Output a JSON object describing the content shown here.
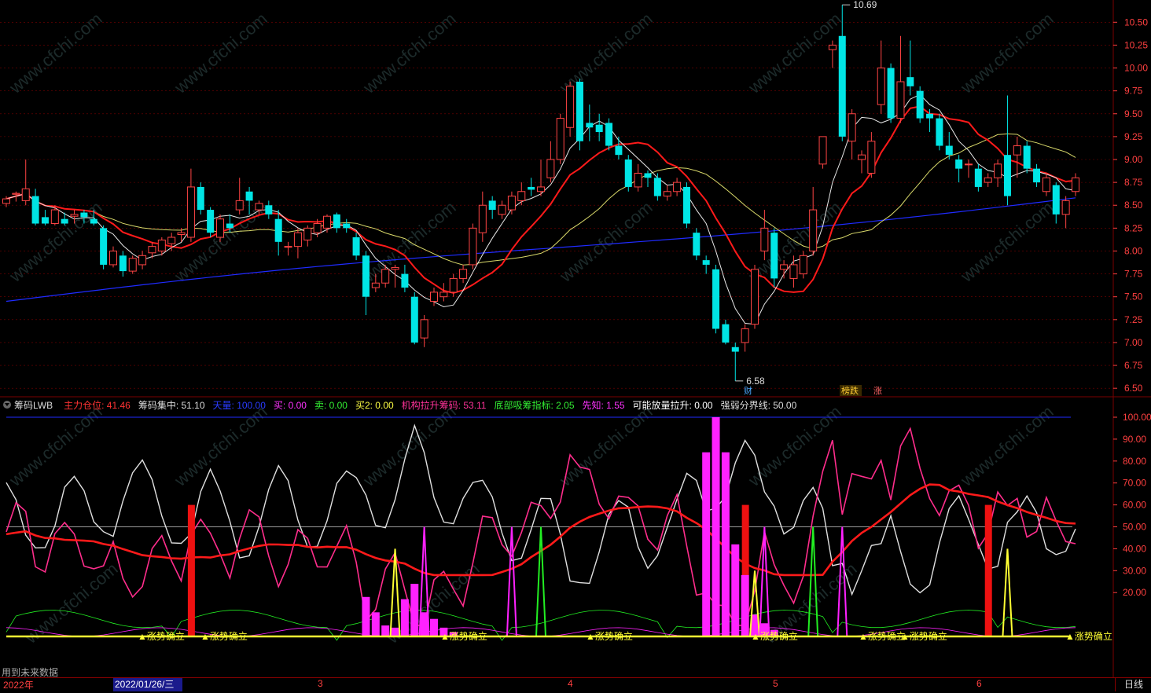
{
  "colors": {
    "up": "#ff4444",
    "down": "#00e5e5",
    "ma_red": "#ff1a1a",
    "ma_white": "#e8e8e8",
    "ma_yellow": "#d9d96a",
    "ma_blue": "#1f2bff",
    "grid": "#7a0000",
    "axis": "#ff4040",
    "pink": "#ff2d8c",
    "magenta": "#ff22ff",
    "green": "#22ee22",
    "yellow": "#ffff33"
  },
  "price_axis": {
    "labels": [
      "10.50",
      "10.25",
      "10.00",
      "9.75",
      "9.50",
      "9.25",
      "9.00",
      "8.75",
      "8.50",
      "8.25",
      "8.00",
      "7.75",
      "7.50",
      "7.25",
      "7.00",
      "6.75",
      "6.50"
    ],
    "min": 6.45,
    "max": 10.7
  },
  "markers": {
    "high": "10.69",
    "low": "6.58",
    "cai": "财",
    "bangdie": "榜跌",
    "zhang": "涨"
  },
  "watermark": "www.cfchi.com",
  "indicator": {
    "title": "筹码LWB",
    "items": [
      {
        "label": "主力仓位:",
        "value": "41.46",
        "color": "#ff3333"
      },
      {
        "label": "筹码集中:",
        "value": "51.10",
        "color": "#dddddd"
      },
      {
        "label": "天量:",
        "value": "100.00",
        "color": "#2a3bff"
      },
      {
        "label": "买:",
        "value": "0.00",
        "color": "#ff33ff"
      },
      {
        "label": "卖:",
        "value": "0.00",
        "color": "#33ee33"
      },
      {
        "label": "买2:",
        "value": "0.00",
        "color": "#ffff44"
      },
      {
        "label": "机构拉升筹码:",
        "value": "53.11",
        "color": "#ff3399"
      },
      {
        "label": "底部吸筹指标:",
        "value": "2.05",
        "color": "#33ee33"
      },
      {
        "label": "先知:",
        "value": "1.55",
        "color": "#ff33ff"
      },
      {
        "label": "可能放量拉升:",
        "value": "0.00",
        "color": "#ffffff"
      },
      {
        "label": "强弱分界线:",
        "value": "50.00",
        "color": "#dddddd"
      }
    ]
  },
  "indicator_axis": {
    "labels": [
      "100.00",
      "90.00",
      "80.00",
      "70.00",
      "60.00",
      "50.00",
      "40.00",
      "30.00",
      "20.00"
    ]
  },
  "signal_text": {
    "rise_confirm": "涨势确立",
    "trend_confirm": "涨势确立"
  },
  "footer": {
    "note": "用到未来数据",
    "year": "2022年",
    "date": "2022/01/26/三",
    "months": [
      "3",
      "4",
      "5",
      "6"
    ],
    "period": "日线"
  },
  "chart_data": {
    "type": "candlestick",
    "ylim": [
      6.45,
      10.7
    ],
    "candles": [
      [
        8.52,
        8.57,
        8.48,
        8.6
      ],
      [
        8.62,
        8.63,
        8.54,
        8.65
      ],
      [
        8.55,
        8.68,
        8.5,
        9.0
      ],
      [
        8.6,
        8.3,
        8.28,
        8.68
      ],
      [
        8.37,
        8.3,
        8.28,
        8.45
      ],
      [
        8.3,
        8.45,
        8.28,
        8.5
      ],
      [
        8.35,
        8.3,
        8.28,
        8.42
      ],
      [
        8.38,
        8.4,
        8.3,
        8.45
      ],
      [
        8.42,
        8.37,
        8.3,
        8.45
      ],
      [
        8.35,
        8.3,
        8.28,
        8.45
      ],
      [
        8.25,
        7.85,
        7.8,
        8.28
      ],
      [
        7.85,
        8.0,
        7.82,
        8.05
      ],
      [
        7.95,
        7.78,
        7.72,
        8.0
      ],
      [
        7.78,
        7.92,
        7.75,
        7.95
      ],
      [
        7.85,
        7.95,
        7.8,
        8.0
      ],
      [
        7.98,
        8.05,
        7.92,
        8.1
      ],
      [
        8.0,
        8.12,
        7.95,
        8.15
      ],
      [
        8.08,
        8.15,
        8.0,
        8.2
      ],
      [
        8.18,
        8.2,
        8.1,
        8.25
      ],
      [
        8.15,
        8.7,
        8.1,
        8.9
      ],
      [
        8.7,
        8.45,
        8.4,
        8.75
      ],
      [
        8.45,
        8.2,
        8.15,
        8.48
      ],
      [
        8.15,
        8.35,
        8.1,
        8.4
      ],
      [
        8.3,
        8.25,
        8.2,
        8.4
      ],
      [
        8.45,
        8.55,
        8.4,
        8.8
      ],
      [
        8.65,
        8.55,
        8.4,
        8.7
      ],
      [
        8.45,
        8.52,
        8.4,
        8.55
      ],
      [
        8.5,
        8.4,
        8.35,
        8.55
      ],
      [
        8.35,
        8.1,
        7.95,
        8.45
      ],
      [
        8.05,
        8.05,
        7.95,
        8.1
      ],
      [
        8.05,
        8.2,
        7.92,
        8.25
      ],
      [
        8.12,
        8.25,
        8.05,
        8.28
      ],
      [
        8.2,
        8.3,
        8.15,
        8.35
      ],
      [
        8.25,
        8.38,
        8.2,
        8.4
      ],
      [
        8.4,
        8.25,
        8.2,
        8.42
      ],
      [
        8.3,
        8.25,
        8.2,
        8.35
      ],
      [
        8.15,
        7.95,
        7.9,
        8.2
      ],
      [
        7.95,
        7.5,
        7.3,
        8.0
      ],
      [
        7.6,
        7.65,
        7.55,
        7.75
      ],
      [
        7.65,
        7.8,
        7.6,
        7.85
      ],
      [
        7.8,
        7.82,
        7.6,
        7.85
      ],
      [
        7.75,
        7.6,
        7.55,
        7.85
      ],
      [
        7.5,
        7.0,
        6.98,
        7.55
      ],
      [
        7.05,
        7.25,
        6.95,
        7.3
      ],
      [
        7.45,
        7.55,
        7.4,
        7.6
      ],
      [
        7.5,
        7.55,
        7.45,
        7.65
      ],
      [
        7.55,
        7.7,
        7.5,
        7.75
      ],
      [
        7.7,
        7.8,
        7.65,
        7.85
      ],
      [
        7.85,
        8.25,
        7.8,
        8.3
      ],
      [
        8.2,
        8.5,
        8.1,
        8.65
      ],
      [
        8.55,
        8.45,
        8.35,
        8.6
      ],
      [
        8.4,
        8.5,
        8.35,
        8.55
      ],
      [
        8.45,
        8.6,
        8.4,
        8.65
      ],
      [
        8.55,
        8.65,
        8.5,
        8.75
      ],
      [
        8.7,
        8.67,
        8.6,
        8.8
      ],
      [
        8.65,
        8.7,
        8.6,
        9.0
      ],
      [
        8.8,
        9.0,
        8.75,
        9.2
      ],
      [
        9.0,
        9.45,
        8.95,
        9.5
      ],
      [
        9.35,
        9.8,
        9.25,
        9.85
      ],
      [
        9.85,
        9.2,
        9.1,
        9.88
      ],
      [
        9.4,
        9.35,
        9.2,
        9.6
      ],
      [
        9.38,
        9.3,
        9.2,
        9.5
      ],
      [
        9.4,
        9.15,
        9.1,
        9.45
      ],
      [
        9.15,
        9.05,
        9.0,
        9.25
      ],
      [
        9.0,
        8.7,
        8.65,
        9.05
      ],
      [
        8.7,
        8.85,
        8.65,
        8.95
      ],
      [
        8.85,
        8.8,
        8.7,
        8.88
      ],
      [
        8.8,
        8.6,
        8.55,
        8.85
      ],
      [
        8.6,
        8.65,
        8.55,
        8.72
      ],
      [
        8.65,
        8.75,
        8.6,
        8.8
      ],
      [
        8.7,
        8.3,
        8.25,
        8.75
      ],
      [
        8.2,
        7.95,
        7.9,
        8.25
      ],
      [
        7.9,
        7.85,
        7.75,
        7.95
      ],
      [
        7.8,
        7.15,
        7.1,
        7.85
      ],
      [
        7.2,
        7.0,
        6.98,
        7.25
      ],
      [
        6.95,
        6.9,
        6.58,
        7.0
      ],
      [
        7.0,
        7.15,
        6.9,
        7.2
      ],
      [
        7.2,
        7.8,
        7.15,
        7.85
      ],
      [
        8.0,
        8.25,
        7.9,
        8.45
      ],
      [
        8.2,
        7.7,
        7.6,
        8.25
      ],
      [
        7.8,
        7.85,
        7.7,
        7.9
      ],
      [
        7.7,
        7.85,
        7.6,
        7.95
      ],
      [
        7.75,
        7.95,
        7.7,
        8.0
      ],
      [
        8.0,
        8.45,
        7.95,
        8.7
      ],
      [
        8.95,
        9.25,
        8.9,
        9.25
      ],
      [
        10.2,
        10.25,
        10.0,
        10.3
      ],
      [
        10.35,
        9.25,
        9.2,
        10.69
      ],
      [
        9.2,
        9.5,
        9.0,
        9.55
      ],
      [
        9.0,
        9.05,
        8.85,
        9.1
      ],
      [
        8.85,
        9.2,
        8.8,
        9.3
      ],
      [
        9.6,
        10.0,
        9.5,
        10.3
      ],
      [
        10.0,
        9.45,
        9.4,
        10.05
      ],
      [
        9.45,
        9.85,
        9.4,
        10.35
      ],
      [
        9.9,
        9.8,
        9.7,
        10.3
      ],
      [
        9.75,
        9.45,
        9.4,
        9.8
      ],
      [
        9.5,
        9.45,
        9.3,
        9.55
      ],
      [
        9.45,
        9.15,
        9.1,
        9.5
      ],
      [
        9.15,
        9.05,
        9.0,
        9.3
      ],
      [
        9.0,
        8.9,
        8.75,
        9.05
      ],
      [
        8.95,
        8.95,
        8.8,
        9.0
      ],
      [
        8.9,
        8.7,
        8.65,
        8.95
      ],
      [
        8.75,
        8.8,
        8.7,
        8.85
      ],
      [
        8.8,
        8.95,
        8.7,
        9.0
      ],
      [
        9.05,
        8.6,
        8.5,
        9.7
      ],
      [
        9.05,
        9.15,
        8.8,
        9.25
      ],
      [
        9.15,
        8.9,
        8.85,
        9.2
      ],
      [
        8.9,
        8.75,
        8.7,
        8.95
      ],
      [
        8.65,
        8.8,
        8.6,
        8.85
      ],
      [
        8.72,
        8.4,
        8.3,
        8.75
      ],
      [
        8.4,
        8.55,
        8.25,
        8.6
      ],
      [
        8.65,
        8.8,
        8.6,
        8.85
      ]
    ]
  }
}
